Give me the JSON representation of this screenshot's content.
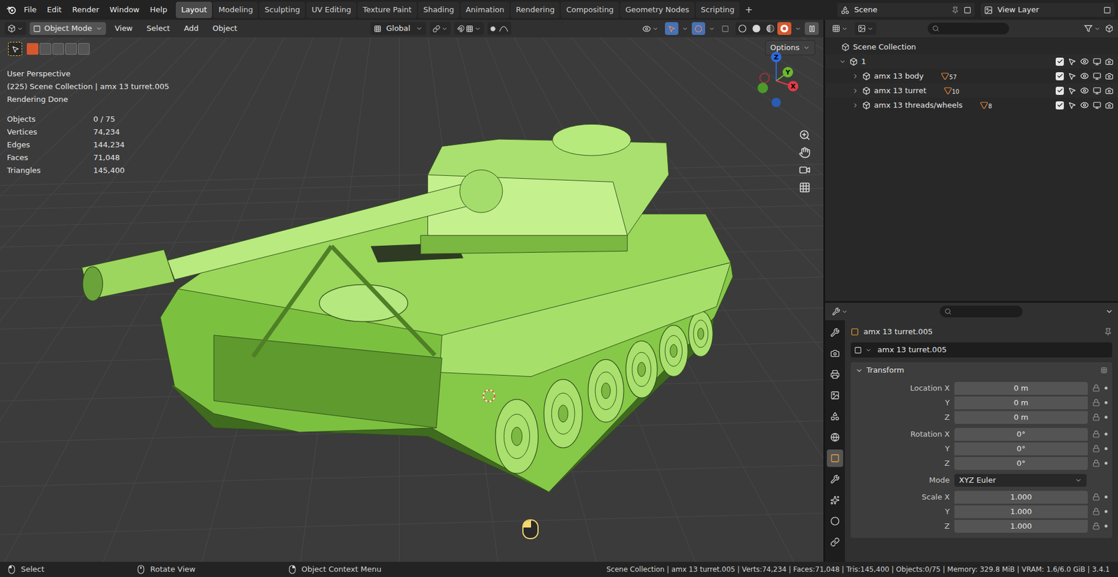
{
  "menu": [
    "File",
    "Edit",
    "Render",
    "Window",
    "Help"
  ],
  "workspaces": [
    {
      "label": "Layout",
      "selected": true
    },
    {
      "label": "Modeling",
      "selected": false
    },
    {
      "label": "Sculpting",
      "selected": false
    },
    {
      "label": "UV Editing",
      "selected": false
    },
    {
      "label": "Texture Paint",
      "selected": false
    },
    {
      "label": "Shading",
      "selected": false
    },
    {
      "label": "Animation",
      "selected": false
    },
    {
      "label": "Rendering",
      "selected": false
    },
    {
      "label": "Compositing",
      "selected": false
    },
    {
      "label": "Geometry Nodes",
      "selected": false
    },
    {
      "label": "Scripting",
      "selected": false
    }
  ],
  "add_workspace": "+",
  "scene": "Scene",
  "view_layer": "View Layer",
  "viewport": {
    "mode": "Object Mode",
    "menus": [
      "View",
      "Select",
      "Add",
      "Object"
    ],
    "orientation": "Global",
    "options": "Options",
    "shading": [
      {
        "selected": false
      },
      {
        "selected": false
      },
      {
        "selected": false
      },
      {
        "selected": true
      }
    ],
    "overlay": [
      "User Perspective",
      "(225) Scene Collection | amx 13 turret.005",
      "Rendering Done"
    ],
    "stats": [
      {
        "label": "Objects",
        "value": "0 / 75"
      },
      {
        "label": "Vertices",
        "value": "74,234"
      },
      {
        "label": "Edges",
        "value": "144,234"
      },
      {
        "label": "Faces",
        "value": "71,048"
      },
      {
        "label": "Triangles",
        "value": "145,400"
      }
    ],
    "gizmo": {
      "x": "X",
      "y": "Y",
      "z": "Z"
    }
  },
  "outliner": {
    "root": "Scene Collection",
    "collections": [
      {
        "name": "1",
        "expanded": true,
        "checked": true,
        "children": [
          {
            "name": "amx 13 body",
            "expanded": false,
            "checked": true,
            "count": "57"
          },
          {
            "name": "amx 13 turret",
            "expanded": false,
            "checked": true,
            "count": "10"
          },
          {
            "name": "amx 13 threads/wheels",
            "expanded": false,
            "checked": true,
            "count": "8"
          }
        ]
      }
    ]
  },
  "properties": {
    "tabs": [
      {
        "selected": false
      },
      {
        "selected": false
      },
      {
        "selected": false
      },
      {
        "selected": false
      },
      {
        "selected": false
      },
      {
        "selected": false
      },
      {
        "selected": true
      },
      {
        "selected": false
      },
      {
        "selected": false
      },
      {
        "selected": false
      },
      {
        "selected": false
      }
    ],
    "object": "amx 13 turret.005",
    "data_name": "amx 13 turret.005",
    "panel": {
      "title": "Transform",
      "expanded": true,
      "groups": [
        {
          "rows": [
            {
              "label": "Location X",
              "value": "0 m",
              "kind": "number"
            },
            {
              "label": "Y",
              "value": "0 m",
              "kind": "number"
            },
            {
              "label": "Z",
              "value": "0 m",
              "kind": "number"
            }
          ]
        },
        {
          "rows": [
            {
              "label": "Rotation X",
              "value": "0°",
              "kind": "number"
            },
            {
              "label": "Y",
              "value": "0°",
              "kind": "number"
            },
            {
              "label": "Z",
              "value": "0°",
              "kind": "number"
            }
          ]
        },
        {
          "rows": [
            {
              "label": "Mode",
              "value": "XYZ Euler",
              "kind": "dropdown"
            }
          ]
        },
        {
          "rows": [
            {
              "label": "Scale X",
              "value": "1.000",
              "kind": "number"
            },
            {
              "label": "Y",
              "value": "1.000",
              "kind": "number"
            },
            {
              "label": "Z",
              "value": "1.000",
              "kind": "number"
            }
          ]
        }
      ]
    }
  },
  "status": {
    "hints": [
      "Select",
      "Rotate View",
      "Object Context Menu"
    ],
    "info": "Scene Collection | amx 13 turret.005 | Verts:74,234 | Faces:71,048 | Tris:145,400 | Objects:0/75 | Memory: 329.8 MiB | VRAM: 1.6/6.0 GiB | 3.4.1"
  }
}
